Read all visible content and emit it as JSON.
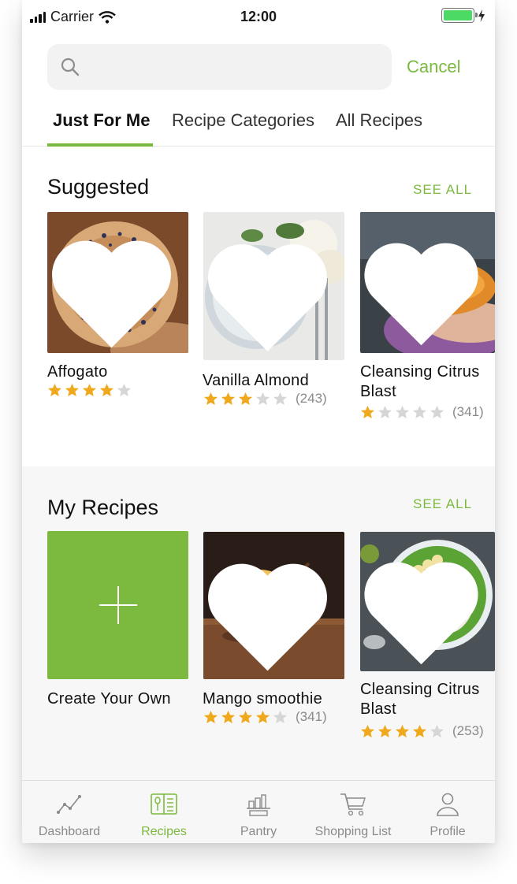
{
  "status_bar": {
    "carrier": "Carrier",
    "time": "12:00"
  },
  "search": {
    "value": "",
    "placeholder": "",
    "cancel_label": "Cancel"
  },
  "tabs": [
    {
      "label": "Just For Me",
      "active": true
    },
    {
      "label": "Recipe Categories",
      "active": false
    },
    {
      "label": "All Recipes",
      "active": false
    }
  ],
  "suggested": {
    "title": "Suggested",
    "see_all": "SEE ALL",
    "items": [
      {
        "title": "Affogato",
        "rating": 4,
        "count": "",
        "image": "donut-photo",
        "favorited": true
      },
      {
        "title": "Vanilla Almond",
        "rating": 3,
        "count": "(243)",
        "image": "waffles-photo",
        "favorited": true
      },
      {
        "title": "Cleansing Citrus Blast",
        "rating": 1,
        "count": "(341)",
        "image": "papaya-bowl-photo",
        "favorited": true
      }
    ]
  },
  "my_recipes": {
    "title": "My Recipes",
    "see_all": "SEE ALL",
    "create_label": "Create Your Own",
    "items": [
      {
        "title": "Mango smoothie",
        "rating": 4,
        "count": "(341)",
        "image": "ice-cream-photo",
        "favorited": true
      },
      {
        "title": "Cleansing Citrus Blast",
        "rating": 4,
        "count": "(253)",
        "image": "green-smoothie-bowl-photo",
        "favorited": true
      }
    ]
  },
  "bottom_nav": [
    {
      "label": "Dashboard",
      "icon": "chart-line-icon",
      "active": false
    },
    {
      "label": "Recipes",
      "icon": "recipe-book-icon",
      "active": true
    },
    {
      "label": "Pantry",
      "icon": "pantry-shelf-icon",
      "active": false
    },
    {
      "label": "Shopping List",
      "icon": "shopping-cart-icon",
      "active": false
    },
    {
      "label": "Profile",
      "icon": "person-icon",
      "active": false
    }
  ],
  "colors": {
    "accent": "#7bb93f",
    "star_filled": "#f0a81c",
    "star_empty": "#d6d6d6"
  }
}
